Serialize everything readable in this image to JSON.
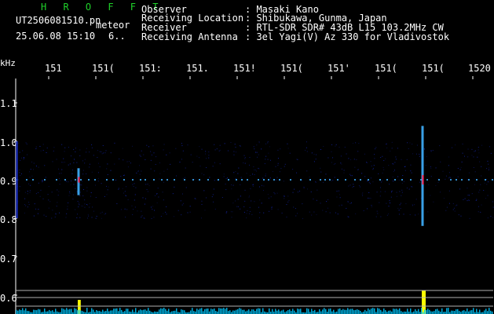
{
  "header": {
    "app_title": "H R O F F T",
    "file_name": "UT2506081510.pn",
    "file_suffix": "meteor",
    "datetime": "25.06.08 15:10",
    "index": "6..",
    "rows": [
      {
        "label": "Observer",
        "value": ": Masaki Kano"
      },
      {
        "label": "Receiving Location",
        "value": ": Shibukawa, Gunma, Japan"
      },
      {
        "label": "Receiver",
        "value": ": RTL-SDR SDR# 43dB L15 103.2MHz CW"
      },
      {
        "label": "Receiving Antenna",
        "value": ": 3el Yagi(V) Az 330 for Vladivostok"
      }
    ]
  },
  "chart_data": {
    "type": "heatmap",
    "title": "",
    "ylabel": "kHz",
    "x_ticks": [
      "151",
      "151(",
      "151:",
      "151.",
      "151!",
      "151(",
      "151'",
      "151(",
      "151(",
      "1520"
    ],
    "y_ticks": [
      "1.1",
      "1.0",
      "0.9",
      "0.8",
      "0.7",
      "0.6"
    ],
    "ylim": [
      0.6,
      1.15
    ],
    "carrier_khz": 0.9,
    "events": [
      {
        "minute": 1511.7,
        "freq_low": 0.86,
        "freq_high": 0.93,
        "strength": 0.6
      },
      {
        "minute": 1519.0,
        "freq_low": 0.78,
        "freq_high": 1.04,
        "strength": 1.0
      }
    ],
    "colors": {
      "background": "#000000",
      "noise": "#1a2fd0",
      "carrier": "#3fb0ff",
      "peak": "#ff2a5a",
      "trace": "#ffff00",
      "baseline": "#00c8ff"
    }
  }
}
